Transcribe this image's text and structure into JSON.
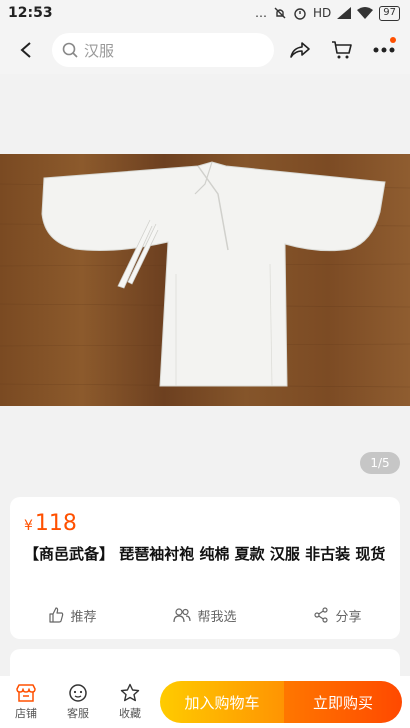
{
  "status": {
    "time": "12:53",
    "network": "HD",
    "battery": "97"
  },
  "search": {
    "placeholder": "汉服"
  },
  "gallery": {
    "indicator": "1/5"
  },
  "product": {
    "currency": "¥",
    "price": "118",
    "title": "【商邑武备】 琵琶袖衬袍  纯棉  夏款 汉服 非古装  现货"
  },
  "actions": [
    {
      "label": "推荐",
      "icon": "thumbs-up-icon"
    },
    {
      "label": "帮我选",
      "icon": "people-icon"
    },
    {
      "label": "分享",
      "icon": "share-icon"
    }
  ],
  "bottom": {
    "tabs": [
      {
        "label": "店铺",
        "icon": "store-icon"
      },
      {
        "label": "客服",
        "icon": "chat-icon"
      },
      {
        "label": "收藏",
        "icon": "star-icon"
      }
    ],
    "cart_label": "加入购物车",
    "buy_label": "立即购买"
  },
  "colors": {
    "accent": "#ff5000",
    "cart": "#ffaa00",
    "buy": "#ff5a00"
  }
}
